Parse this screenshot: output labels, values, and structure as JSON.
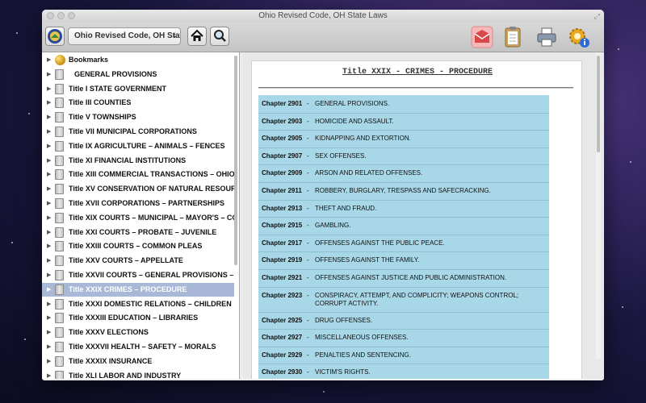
{
  "window": {
    "title": "Ohio Revised Code, OH State Laws"
  },
  "toolbar": {
    "book_selector_value": "Ohio Revised Code, OH State...",
    "buttons": [
      {
        "name": "home-button",
        "icon": "home-icon"
      },
      {
        "name": "search-button",
        "icon": "magnifier-icon"
      }
    ],
    "right_buttons": [
      {
        "name": "mail-button",
        "icon": "envelope-icon"
      },
      {
        "name": "notes-button",
        "icon": "clipboard-icon"
      },
      {
        "name": "print-button",
        "icon": "printer-icon"
      },
      {
        "name": "settings-button",
        "icon": "gear-info-icon"
      }
    ]
  },
  "sidebar": {
    "items": [
      {
        "label": "Bookmarks",
        "icon": "bookmark-icon"
      },
      {
        "label": "GENERAL PROVISIONS",
        "icon": "book-icon"
      },
      {
        "label": "Title I  STATE GOVERNMENT",
        "icon": "book-icon"
      },
      {
        "label": "Title III  COUNTIES",
        "icon": "book-icon"
      },
      {
        "label": "Title V  TOWNSHIPS",
        "icon": "book-icon"
      },
      {
        "label": "Title VII  MUNICIPAL CORPORATIONS",
        "icon": "book-icon"
      },
      {
        "label": "Title IX  AGRICULTURE – ANIMALS – FENCES",
        "icon": "book-icon"
      },
      {
        "label": "Title XI  FINANCIAL INSTITUTIONS",
        "icon": "book-icon"
      },
      {
        "label": "Title XIII  COMMERCIAL TRANSACTIONS – OHIO UN",
        "icon": "book-icon"
      },
      {
        "label": "Title XV  CONSERVATION OF NATURAL RESOURCES",
        "icon": "book-icon"
      },
      {
        "label": "Title XVII  CORPORATIONS – PARTNERSHIPS",
        "icon": "book-icon"
      },
      {
        "label": "Title XIX  COURTS – MUNICIPAL – MAYOR'S – COUN",
        "icon": "book-icon"
      },
      {
        "label": "Title XXI  COURTS – PROBATE – JUVENILE",
        "icon": "book-icon"
      },
      {
        "label": "Title XXIII  COURTS – COMMON PLEAS",
        "icon": "book-icon"
      },
      {
        "label": "Title XXV  COURTS – APPELLATE",
        "icon": "book-icon"
      },
      {
        "label": "Title XXVII  COURTS – GENERAL PROVISIONS – SPEC",
        "icon": "book-icon"
      },
      {
        "label": "Title XXIX  CRIMES – PROCEDURE",
        "icon": "book-icon",
        "selected": true
      },
      {
        "label": "Title XXXI  DOMESTIC RELATIONS – CHILDREN",
        "icon": "book-icon"
      },
      {
        "label": "Title XXXIII  EDUCATION – LIBRARIES",
        "icon": "book-icon"
      },
      {
        "label": "Title XXXV  ELECTIONS",
        "icon": "book-icon"
      },
      {
        "label": "Title XXXVII  HEALTH – SAFETY – MORALS",
        "icon": "book-icon"
      },
      {
        "label": "Title XXXIX  INSURANCE",
        "icon": "book-icon"
      },
      {
        "label": "Title XLI  LABOR AND INDUSTRY",
        "icon": "book-icon"
      }
    ]
  },
  "content": {
    "title": "Title XXIX - CRIMES - PROCEDURE",
    "chapters": [
      {
        "number": "Chapter 2901",
        "name": "GENERAL PROVISIONS."
      },
      {
        "number": "Chapter 2903",
        "name": "HOMICIDE AND ASSAULT."
      },
      {
        "number": "Chapter 2905",
        "name": "KIDNAPPING AND EXTORTION."
      },
      {
        "number": "Chapter 2907",
        "name": "SEX OFFENSES."
      },
      {
        "number": "Chapter 2909",
        "name": "ARSON AND RELATED OFFENSES."
      },
      {
        "number": "Chapter 2911",
        "name": "ROBBERY, BURGLARY, TRESPASS AND SAFECRACKING."
      },
      {
        "number": "Chapter 2913",
        "name": "THEFT AND FRAUD."
      },
      {
        "number": "Chapter 2915",
        "name": "GAMBLING."
      },
      {
        "number": "Chapter 2917",
        "name": "OFFENSES AGAINST THE PUBLIC PEACE."
      },
      {
        "number": "Chapter 2919",
        "name": "OFFENSES AGAINST THE FAMILY."
      },
      {
        "number": "Chapter 2921",
        "name": "OFFENSES AGAINST JUSTICE AND PUBLIC ADMINISTRATION."
      },
      {
        "number": "Chapter 2923",
        "name": "CONSPIRACY, ATTEMPT, AND COMPLICITY; WEAPONS CONTROL; CORRUPT ACTIVITY."
      },
      {
        "number": "Chapter 2925",
        "name": "DRUG OFFENSES."
      },
      {
        "number": "Chapter 2927",
        "name": "MISCELLANEOUS OFFENSES."
      },
      {
        "number": "Chapter 2929",
        "name": "PENALTIES AND SENTENCING."
      },
      {
        "number": "Chapter 2930",
        "name": "VICTIM'S RIGHTS."
      }
    ]
  },
  "colors": {
    "selection": "#a9b8d6",
    "table_bg": "#a8d8e8"
  }
}
